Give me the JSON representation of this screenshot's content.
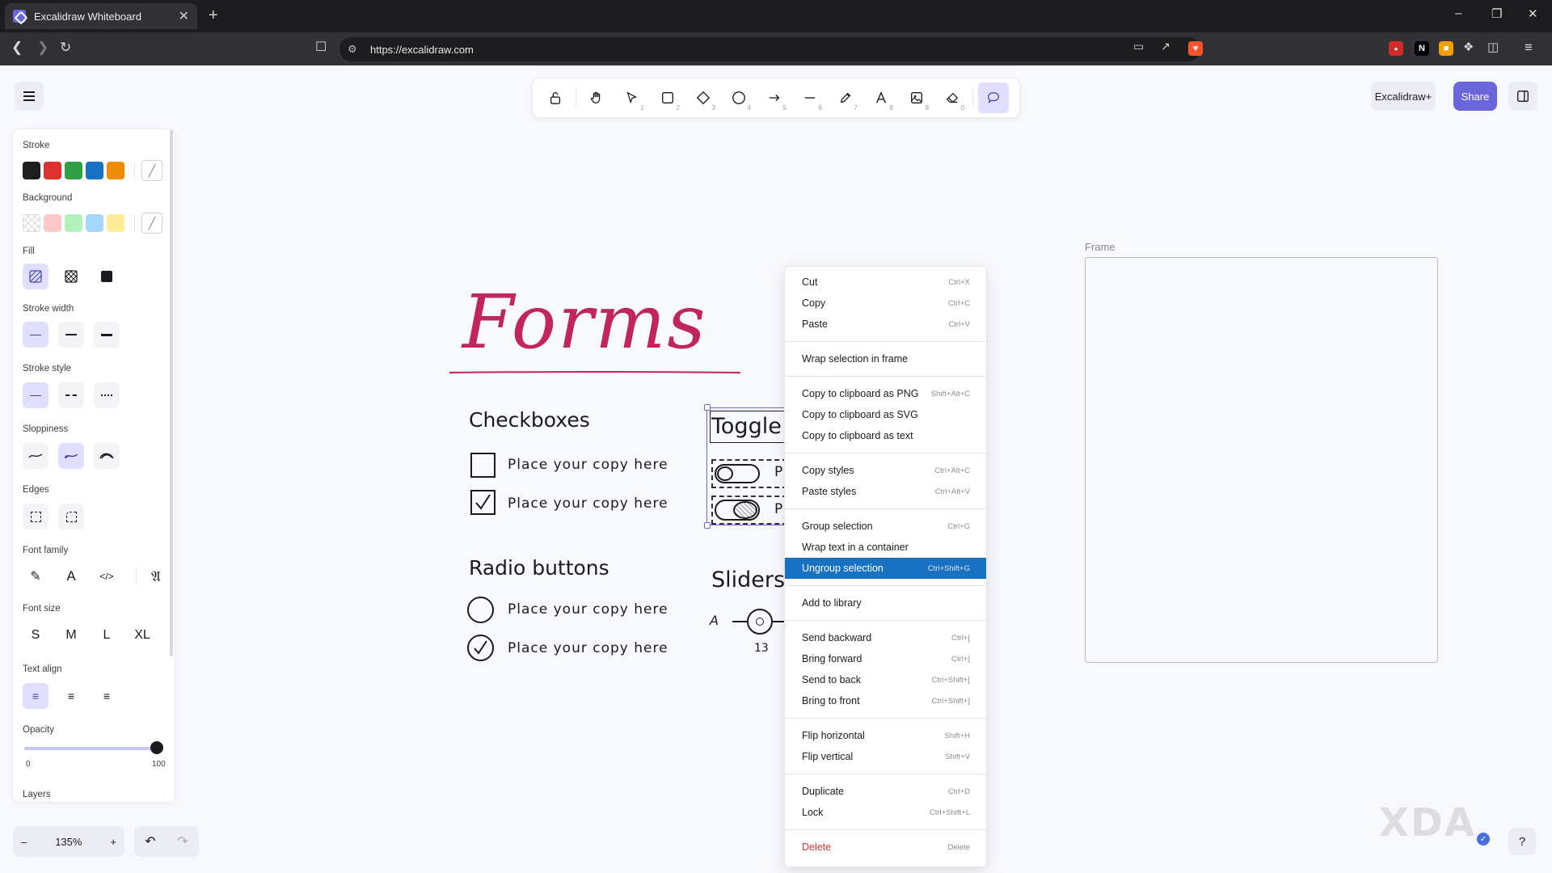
{
  "browser": {
    "tab_title": "Excalidraw Whiteboard",
    "tab_close": "✕",
    "new_tab": "+",
    "url": "https://excalidraw.com",
    "win_min": "–",
    "win_max": "❐",
    "win_close": "✕"
  },
  "toolbar": {
    "tools": [
      {
        "name": "lock",
        "icon": "lock-icon",
        "key": ""
      },
      {
        "name": "hand",
        "icon": "hand-icon",
        "key": ""
      },
      {
        "name": "selection",
        "icon": "pointer-icon",
        "key": "1"
      },
      {
        "name": "rectangle",
        "icon": "square-icon",
        "key": "2"
      },
      {
        "name": "diamond",
        "icon": "diamond-icon",
        "key": "3"
      },
      {
        "name": "ellipse",
        "icon": "circle-icon",
        "key": "4"
      },
      {
        "name": "arrow",
        "icon": "arrow-icon",
        "key": "5"
      },
      {
        "name": "line",
        "icon": "line-icon",
        "key": "6"
      },
      {
        "name": "draw",
        "icon": "pencil-icon",
        "key": "7"
      },
      {
        "name": "text",
        "icon": "text-icon",
        "key": "8"
      },
      {
        "name": "image",
        "icon": "image-icon",
        "key": "9"
      },
      {
        "name": "eraser",
        "icon": "eraser-icon",
        "key": "0"
      },
      {
        "name": "laser",
        "icon": "speech-bubble-icon",
        "key": "",
        "active": true
      }
    ],
    "plus_label": "Excalidraw+",
    "share_label": "Share"
  },
  "properties": {
    "stroke_label": "Stroke",
    "stroke_colors": [
      "#1e1e1e",
      "#e03131",
      "#2f9e44",
      "#1971c2",
      "#f08c00"
    ],
    "background_label": "Background",
    "background_colors": [
      "transparent",
      "#ffc9c9",
      "#b2f2bb",
      "#a5d8ff",
      "#ffec99"
    ],
    "fill_label": "Fill",
    "stroke_width_label": "Stroke width",
    "stroke_style_label": "Stroke style",
    "sloppiness_label": "Sloppiness",
    "edges_label": "Edges",
    "font_family_label": "Font family",
    "font_size_label": "Font size",
    "font_sizes": [
      "S",
      "M",
      "L",
      "XL"
    ],
    "text_align_label": "Text align",
    "opacity_label": "Opacity",
    "opacity_min": "0",
    "opacity_max": "100",
    "opacity_value": 100,
    "layers_label": "Layers"
  },
  "zoom": {
    "minus": "–",
    "value": "135%",
    "plus": "+"
  },
  "undo": {
    "undo": "↶",
    "redo": "↷"
  },
  "canvas": {
    "title": "Forms",
    "checkboxes_heading": "Checkboxes",
    "checkbox_items": [
      "Place your copy here",
      "Place your copy here"
    ],
    "radio_heading": "Radio buttons",
    "radio_items": [
      "Place your copy here",
      "Place your copy here"
    ],
    "toggle_heading": "Toggle",
    "toggle_partial": [
      "P",
      "P"
    ],
    "sliders_heading": "Sliders",
    "slider_letter": "A",
    "slider_value": "13",
    "frame_label": "Frame"
  },
  "context_menu": {
    "groups": [
      [
        {
          "label": "Cut",
          "shortcut": "Ctrl+X"
        },
        {
          "label": "Copy",
          "shortcut": "Ctrl+C"
        },
        {
          "label": "Paste",
          "shortcut": "Ctrl+V"
        }
      ],
      [
        {
          "label": "Wrap selection in frame",
          "shortcut": ""
        }
      ],
      [
        {
          "label": "Copy to clipboard as PNG",
          "shortcut": "Shift+Alt+C"
        },
        {
          "label": "Copy to clipboard as SVG",
          "shortcut": ""
        },
        {
          "label": "Copy to clipboard as text",
          "shortcut": ""
        }
      ],
      [
        {
          "label": "Copy styles",
          "shortcut": "Ctrl+Alt+C"
        },
        {
          "label": "Paste styles",
          "shortcut": "Ctrl+Alt+V"
        }
      ],
      [
        {
          "label": "Group selection",
          "shortcut": "Ctrl+G"
        },
        {
          "label": "Wrap text in a container",
          "shortcut": ""
        },
        {
          "label": "Ungroup selection",
          "shortcut": "Ctrl+Shift+G",
          "highlighted": true
        }
      ],
      [
        {
          "label": "Add to library",
          "shortcut": ""
        }
      ],
      [
        {
          "label": "Send backward",
          "shortcut": "Ctrl+["
        },
        {
          "label": "Bring forward",
          "shortcut": "Ctrl+]"
        },
        {
          "label": "Send to back",
          "shortcut": "Ctrl+Shift+["
        },
        {
          "label": "Bring to front",
          "shortcut": "Ctrl+Shift+]"
        }
      ],
      [
        {
          "label": "Flip horizontal",
          "shortcut": "Shift+H"
        },
        {
          "label": "Flip vertical",
          "shortcut": "Shift+V"
        }
      ],
      [
        {
          "label": "Duplicate",
          "shortcut": "Ctrl+D"
        },
        {
          "label": "Lock",
          "shortcut": "Ctrl+Shift+L"
        }
      ],
      [
        {
          "label": "Delete",
          "shortcut": "Delete",
          "danger": true
        }
      ]
    ]
  },
  "watermark": "XDA",
  "help": "?"
}
